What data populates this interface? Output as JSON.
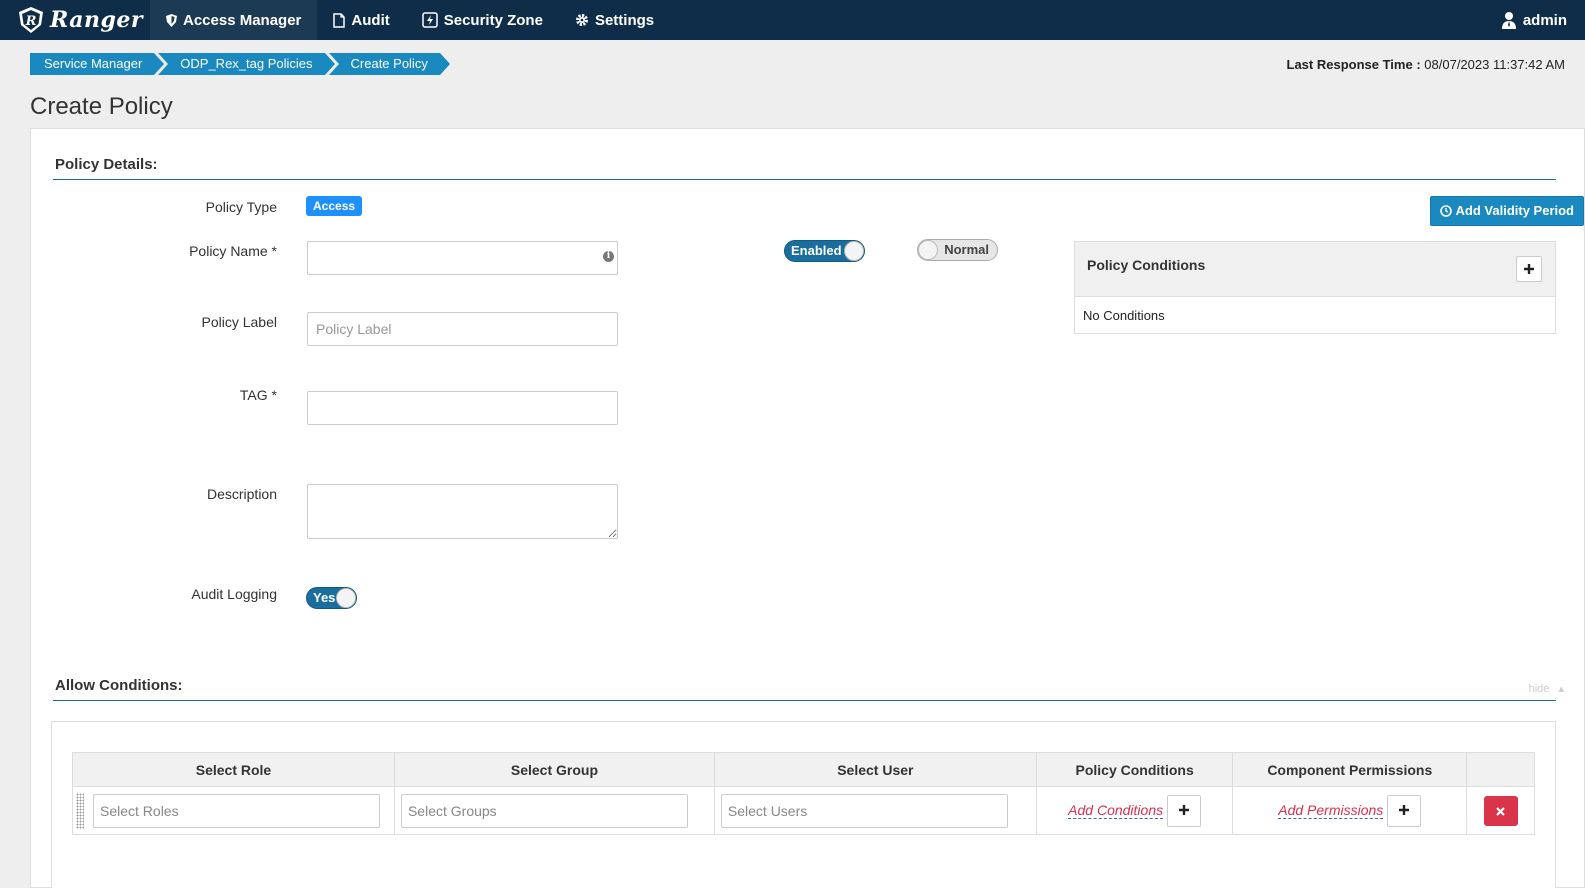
{
  "nav": {
    "brand": "Ranger",
    "items": [
      {
        "label": "Access Manager",
        "icon": "shield-icon"
      },
      {
        "label": "Audit",
        "icon": "file-icon"
      },
      {
        "label": "Security Zone",
        "icon": "bolt-icon"
      },
      {
        "label": "Settings",
        "icon": "gear-icon"
      }
    ],
    "user": "admin"
  },
  "breadcrumb": [
    "Service Manager",
    "ODP_Rex_tag Policies",
    "Create Policy"
  ],
  "last_response": {
    "label": "Last Response Time :",
    "value": "08/07/2023 11:37:42 AM"
  },
  "page_title": "Create Policy",
  "policy_details": {
    "title": "Policy Details:",
    "policy_type_label": "Policy Type",
    "policy_type_value": "Access",
    "policy_name_label": "Policy Name *",
    "policy_name_value": "",
    "policy_label_label": "Policy Label",
    "policy_label_placeholder": "Policy Label",
    "tag_label": "TAG *",
    "description_label": "Description",
    "audit_logging_label": "Audit Logging",
    "audit_logging_toggle": "Yes",
    "enabled_toggle": "Enabled",
    "normal_toggle": "Normal",
    "add_validity_button": "Add Validity Period",
    "policy_conditions_title": "Policy Conditions",
    "policy_conditions_empty": "No Conditions"
  },
  "allow_conditions": {
    "title": "Allow Conditions:",
    "hide_link": "hide",
    "columns": [
      "Select Role",
      "Select Group",
      "Select User",
      "Policy Conditions",
      "Component Permissions",
      ""
    ],
    "row": {
      "roles_placeholder": "Select Roles",
      "groups_placeholder": "Select Groups",
      "users_placeholder": "Select Users",
      "add_conditions": "Add Conditions",
      "add_permissions": "Add Permissions"
    }
  },
  "colors": {
    "nav_bg": "#0f2d48",
    "accent": "#1989bf",
    "danger": "#d9344a",
    "access_badge": "#1e90ff"
  }
}
